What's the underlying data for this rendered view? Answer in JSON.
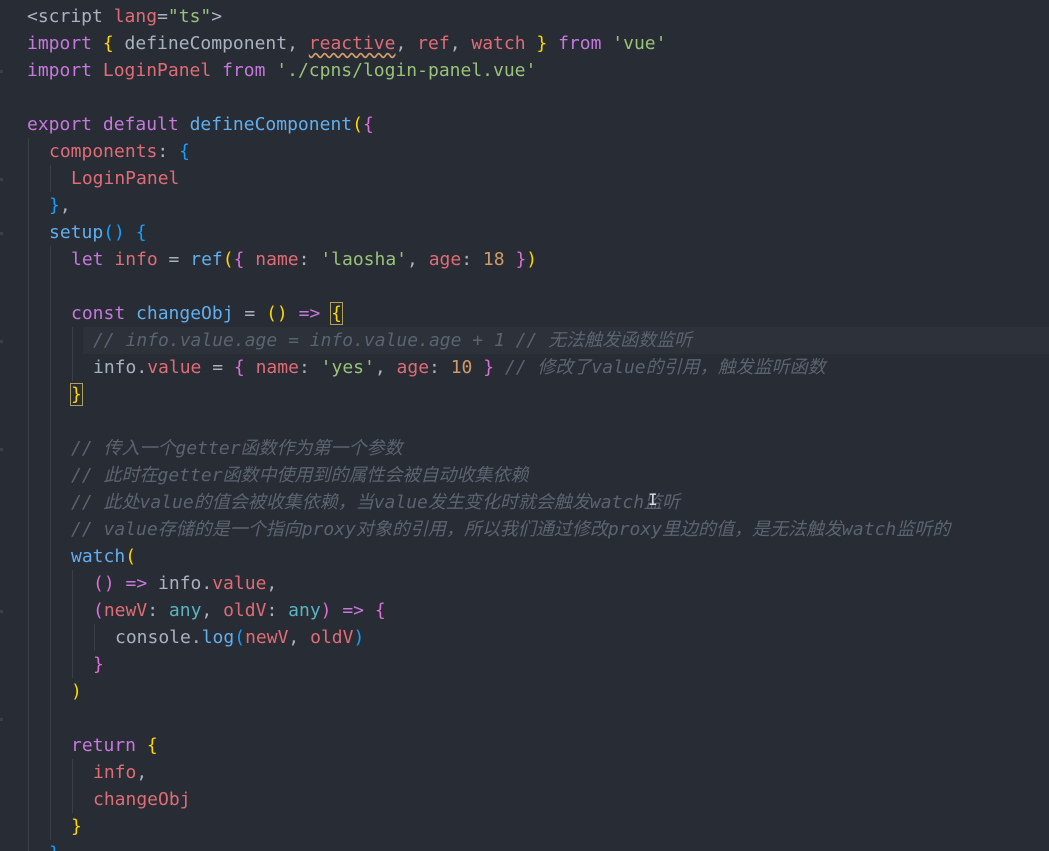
{
  "lines": [
    {
      "depth": 0,
      "tokens": [
        [
          "tag",
          "<script "
        ],
        [
          "prop",
          "lang"
        ],
        [
          "pun",
          "="
        ],
        [
          "str",
          "\"ts\""
        ],
        [
          "tag",
          ">"
        ]
      ]
    },
    {
      "depth": 0,
      "tokens": [
        [
          "kw",
          "import "
        ],
        [
          "br1",
          "{ "
        ],
        [
          "pun",
          "defineComponent, "
        ],
        [
          "prop warn",
          "reactive"
        ],
        [
          "pun",
          ", "
        ],
        [
          "prop",
          "ref"
        ],
        [
          "pun",
          ", "
        ],
        [
          "prop",
          "watch "
        ],
        [
          "br1",
          "} "
        ],
        [
          "kw",
          "from "
        ],
        [
          "str",
          "'vue'"
        ]
      ]
    },
    {
      "depth": 0,
      "tokens": [
        [
          "kw",
          "import "
        ],
        [
          "prop",
          "LoginPanel "
        ],
        [
          "kw",
          "from "
        ],
        [
          "str",
          "'./cpns/login-panel.vue'"
        ]
      ]
    },
    {
      "depth": 0,
      "tokens": []
    },
    {
      "depth": 0,
      "tokens": [
        [
          "kw",
          "export default "
        ],
        [
          "fn",
          "defineComponent"
        ],
        [
          "br1",
          "("
        ],
        [
          "br2",
          "{"
        ]
      ]
    },
    {
      "depth": 1,
      "tokens": [
        [
          "prop",
          "components"
        ],
        [
          "pun",
          ": "
        ],
        [
          "br3",
          "{"
        ]
      ]
    },
    {
      "depth": 2,
      "tokens": [
        [
          "prop",
          "LoginPanel"
        ]
      ]
    },
    {
      "depth": 1,
      "tokens": [
        [
          "br3",
          "}"
        ],
        [
          "pun",
          ","
        ]
      ]
    },
    {
      "depth": 1,
      "tokens": [
        [
          "fn",
          "setup"
        ],
        [
          "br3",
          "() {"
        ]
      ]
    },
    {
      "depth": 2,
      "tokens": [
        [
          "kw",
          "let "
        ],
        [
          "prop",
          "info "
        ],
        [
          "pun",
          "= "
        ],
        [
          "fn",
          "ref"
        ],
        [
          "br1",
          "("
        ],
        [
          "br2",
          "{ "
        ],
        [
          "prop",
          "name"
        ],
        [
          "pun",
          ": "
        ],
        [
          "str",
          "'laosha'"
        ],
        [
          "pun",
          ", "
        ],
        [
          "prop",
          "age"
        ],
        [
          "pun",
          ": "
        ],
        [
          "num",
          "18 "
        ],
        [
          "br2",
          "}"
        ],
        [
          "br1",
          ")"
        ]
      ]
    },
    {
      "depth": 2,
      "tokens": []
    },
    {
      "depth": 2,
      "tokens": [
        [
          "kw",
          "const "
        ],
        [
          "fn",
          "changeObj "
        ],
        [
          "pun",
          "= "
        ],
        [
          "br1",
          "() "
        ],
        [
          "kw",
          "=> "
        ],
        [
          "br1 bracket-box",
          "{"
        ]
      ]
    },
    {
      "depth": 3,
      "active": true,
      "tokens": [
        [
          "cmt",
          "// info.value.age = info.value.age + 1 // 无法触发函数监听"
        ]
      ]
    },
    {
      "depth": 3,
      "tokens": [
        [
          "pun",
          "info."
        ],
        [
          "prop",
          "value "
        ],
        [
          "pun",
          "= "
        ],
        [
          "br2",
          "{ "
        ],
        [
          "prop",
          "name"
        ],
        [
          "pun",
          ": "
        ],
        [
          "str",
          "'yes'"
        ],
        [
          "pun",
          ", "
        ],
        [
          "prop",
          "age"
        ],
        [
          "pun",
          ": "
        ],
        [
          "num",
          "10 "
        ],
        [
          "br2",
          "} "
        ],
        [
          "cmt",
          "// 修改了value的引用，触发监听函数"
        ]
      ]
    },
    {
      "depth": 2,
      "tokens": [
        [
          "br1 bracket-box",
          "}"
        ]
      ]
    },
    {
      "depth": 2,
      "tokens": []
    },
    {
      "depth": 2,
      "tokens": [
        [
          "cmt",
          "// 传入一个getter函数作为第一个参数"
        ]
      ]
    },
    {
      "depth": 2,
      "tokens": [
        [
          "cmt",
          "// 此时在getter函数中使用到的属性会被自动收集依赖"
        ]
      ]
    },
    {
      "depth": 2,
      "tokens": [
        [
          "cmt",
          "// 此处value的值会被收集依赖，当value发生变化时就会触发watch监听"
        ]
      ]
    },
    {
      "depth": 2,
      "tokens": [
        [
          "cmt",
          "// value存储的是一个指向proxy对象的引用，所以我们通过修改proxy里边的值，是无法触发watch监听的"
        ]
      ]
    },
    {
      "depth": 2,
      "tokens": [
        [
          "fn",
          "watch"
        ],
        [
          "br1",
          "("
        ]
      ]
    },
    {
      "depth": 3,
      "tokens": [
        [
          "br2",
          "() "
        ],
        [
          "kw",
          "=> "
        ],
        [
          "pun",
          "info."
        ],
        [
          "prop",
          "value"
        ],
        [
          "pun",
          ","
        ]
      ]
    },
    {
      "depth": 3,
      "tokens": [
        [
          "br2",
          "("
        ],
        [
          "prop",
          "newV"
        ],
        [
          "pun",
          ": "
        ],
        [
          "typ",
          "any"
        ],
        [
          "pun",
          ", "
        ],
        [
          "prop",
          "oldV"
        ],
        [
          "pun",
          ": "
        ],
        [
          "typ",
          "any"
        ],
        [
          "br2",
          ") "
        ],
        [
          "kw",
          "=> "
        ],
        [
          "br2",
          "{"
        ]
      ]
    },
    {
      "depth": 4,
      "tokens": [
        [
          "pun",
          "console."
        ],
        [
          "fn",
          "log"
        ],
        [
          "br3",
          "("
        ],
        [
          "prop",
          "newV"
        ],
        [
          "pun",
          ", "
        ],
        [
          "prop",
          "oldV"
        ],
        [
          "br3",
          ")"
        ]
      ]
    },
    {
      "depth": 3,
      "tokens": [
        [
          "br2",
          "}"
        ]
      ]
    },
    {
      "depth": 2,
      "tokens": [
        [
          "br1",
          ")"
        ]
      ]
    },
    {
      "depth": 2,
      "tokens": []
    },
    {
      "depth": 2,
      "tokens": [
        [
          "kw",
          "return "
        ],
        [
          "br1",
          "{"
        ]
      ]
    },
    {
      "depth": 3,
      "tokens": [
        [
          "prop",
          "info"
        ],
        [
          "pun",
          ","
        ]
      ]
    },
    {
      "depth": 3,
      "tokens": [
        [
          "prop",
          "changeObj"
        ]
      ]
    },
    {
      "depth": 2,
      "tokens": [
        [
          "br1",
          "}"
        ]
      ]
    },
    {
      "depth": 1,
      "tokens": [
        [
          "br3",
          "}"
        ]
      ]
    }
  ]
}
